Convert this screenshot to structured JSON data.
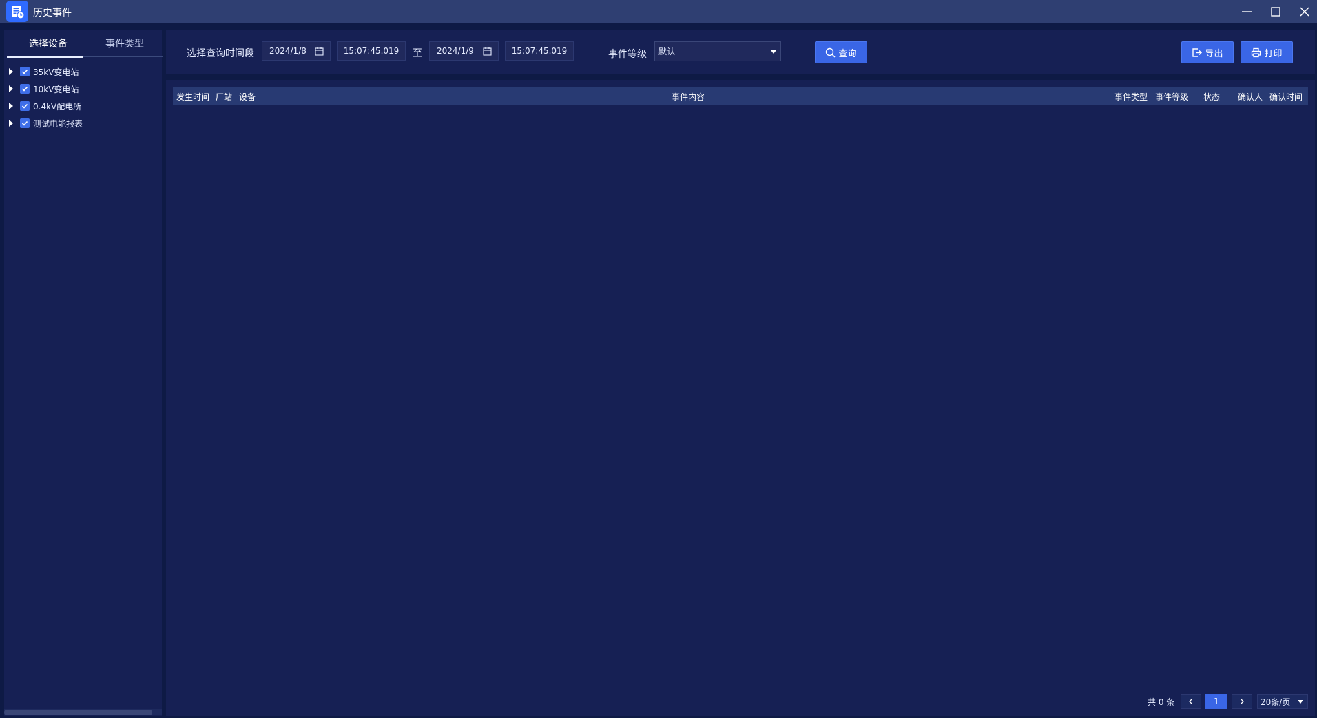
{
  "window": {
    "title": "历史事件",
    "icon": "document-clock-icon",
    "controls": [
      "minimize-icon",
      "maximize-icon",
      "close-icon"
    ]
  },
  "left_panel": {
    "tabs": [
      {
        "label": "选择设备",
        "active": true
      },
      {
        "label": "事件类型",
        "active": false
      }
    ],
    "tree": [
      {
        "label": "35kV变电站",
        "checked": true
      },
      {
        "label": "10kV变电站",
        "checked": true
      },
      {
        "label": "0.4kV配电所",
        "checked": true
      },
      {
        "label": "测试电能报表",
        "checked": true
      }
    ]
  },
  "toolbar": {
    "time_range_label": "选择查询时间段",
    "start_date": "2024/1/8",
    "start_time": "15:07:45.019",
    "to_label": "至",
    "end_date": "2024/1/9",
    "end_time": "15:07:45.019",
    "level_label": "事件等级",
    "level_value": "默认",
    "query_label": "查询",
    "export_label": "导出",
    "print_label": "打印"
  },
  "table": {
    "headers": [
      "发生时间",
      "厂站",
      "设备",
      "事件内容",
      "事件类型",
      "事件等级",
      "状态",
      "确认人",
      "确认时间"
    ],
    "rows": []
  },
  "pagination": {
    "total_text": "共 0 条",
    "current_page": "1",
    "page_size": "20条/页"
  },
  "colors": {
    "background": "#0e1a45",
    "panel": "#162054",
    "titlebar": "#2f3f72",
    "accent": "#3a66e6",
    "header_row": "#283a73"
  }
}
